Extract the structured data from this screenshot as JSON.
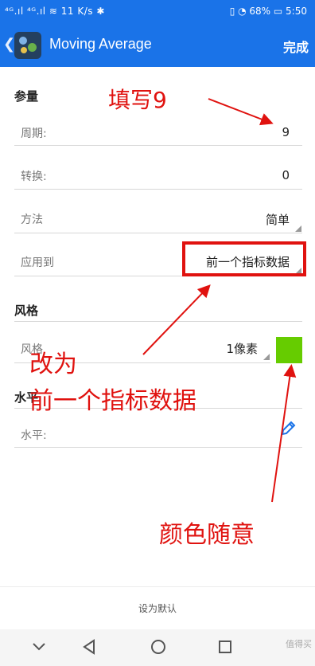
{
  "status_bar": {
    "left": "⁴ᴳ.ıl ⁴ᴳ.ıl ≋ 11 K/s ✱",
    "right": "▯ ◔ 68% ▭ 5:50"
  },
  "header": {
    "title": "Moving Average",
    "done_label": "完成"
  },
  "params": {
    "section": "参量",
    "period": {
      "label": "周期:",
      "value": "9"
    },
    "shift": {
      "label": "转换:",
      "value": "0"
    },
    "method": {
      "label": "方法",
      "value": "简单"
    },
    "apply_to": {
      "label": "应用到",
      "value": "前一个指标数据"
    }
  },
  "style": {
    "section": "风格",
    "row": {
      "label": "风格",
      "value": "1像素"
    },
    "colors": {
      "swatch": "#66cc00",
      "accent": "#1a73e8",
      "annotation": "#e0120f"
    }
  },
  "levels": {
    "section": "水平",
    "row": {
      "label": "水平:"
    }
  },
  "footer": {
    "set_default": "设为默认"
  },
  "annotations": {
    "fill9": "填写9",
    "change_to_1": "改为",
    "change_to_2": "前一个指标数据",
    "color_any": "颜色随意"
  },
  "watermark": "值得买"
}
